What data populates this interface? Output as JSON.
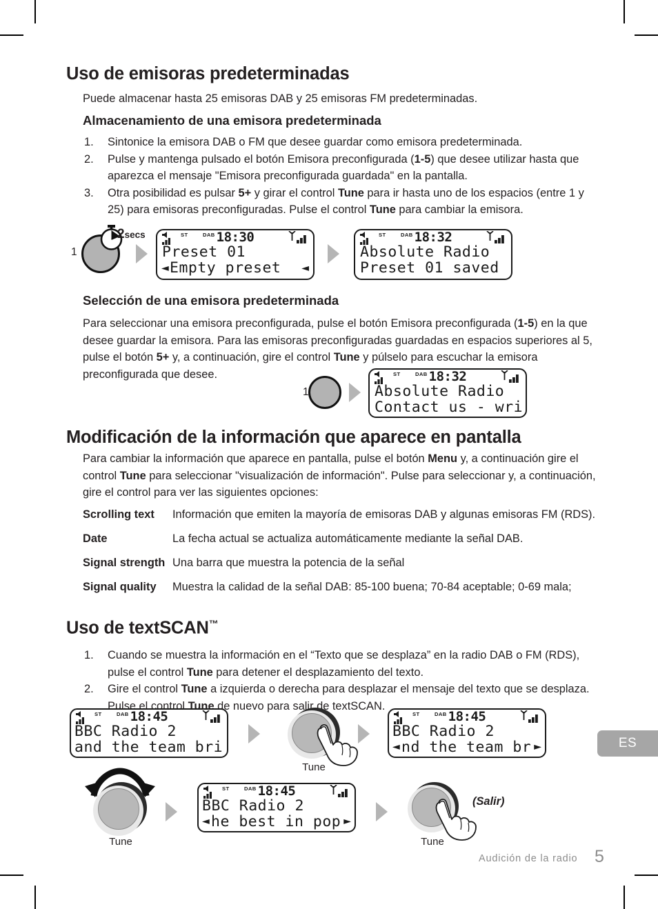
{
  "page": {
    "number": "5",
    "footer_section": "Audición de la radio",
    "language_tab": "ES"
  },
  "sections": {
    "presets": {
      "heading": "Uso de emisoras predeterminadas",
      "intro": "Puede almacenar hasta 25 emisoras DAB y 25 emisoras FM predeterminadas.",
      "store_heading": "Almacenamiento de una emisora predeterminada",
      "steps": [
        {
          "num": "1.",
          "text": "Sintonice la emisora DAB o FM que desee guardar como emisora predeterminada."
        },
        {
          "num": "2.",
          "text": "Pulse y mantenga pulsado el botón Emisora preconfigurada (1-5) que desee utilizar hasta que aparezca el mensaje \"Emisora preconfigurada guardada\" en la pantalla."
        },
        {
          "num": "3.",
          "text": "Otra posibilidad es pulsar 5+ y girar el control Tune para ir hasta uno de los espacios (entre 1 y 25) para emisoras preconfiguradas. Pulse el control Tune para cambiar la emisora."
        }
      ],
      "select_heading": "Selección de una emisora predeterminada",
      "select_body": "Para seleccionar una emisora preconfigurada, pulse el botón Emisora preconfigurada (1-5) en la que desee guardar la emisora. Para las emisoras preconfiguradas guardadas en espacios superiores al 5, pulse el botón 5+ y, a continuación, gire el control Tune y púlselo para escuchar la emisora preconfigurada que desee."
    },
    "display_info": {
      "heading": "Modificación de la información que aparece en pantalla",
      "body": "Para cambiar la información que aparece en pantalla, pulse el botón Menu y, a continuación gire el control Tune para seleccionar \"visualización de información\". Pulse para seleccionar y, a continuación, gire el control para ver las siguientes opciones:",
      "options": [
        {
          "term": "Scrolling text",
          "desc": "Información que emiten la mayoría de emisoras DAB y algunas emisoras FM (RDS)."
        },
        {
          "term": "Date",
          "desc": "La fecha actual se actualiza automáticamente mediante la señal DAB."
        },
        {
          "term": "Signal strength",
          "desc": "Una barra que muestra la potencia de la señal"
        },
        {
          "term": "Signal quality",
          "desc": "Muestra la calidad de la señal DAB: 85-100 buena; 70-84 aceptable; 0-69 mala;"
        }
      ]
    },
    "textscan": {
      "heading": "Uso de textSCAN",
      "heading_tm": "™",
      "steps": [
        {
          "num": "1.",
          "text": "Cuando se muestra la información en el “Texto que se desplaza” en la radio DAB o FM (RDS), pulse el control Tune para detener el desplazamiento del texto."
        },
        {
          "num": "2.",
          "text": "Gire el control Tune a izquierda o derecha para desplazar el mensaje del texto que se desplaza. Pulse el control Tune de nuevo para salir de textSCAN."
        }
      ]
    }
  },
  "diagrams": {
    "store_preset": {
      "step_label": "1",
      "hold_time": "2",
      "hold_unit": "secs",
      "screen_a": {
        "st": "ST",
        "dab": "DAB",
        "time": "18:30",
        "line1": "Preset 01",
        "line2": "Empty preset",
        "left_mark": "◄",
        "right_mark": "◄"
      },
      "screen_b": {
        "st": "ST",
        "dab": "DAB",
        "time": "18:32",
        "line1": "Absolute Radio",
        "line2": "Preset 01 saved"
      }
    },
    "select_preset": {
      "step_label": "1",
      "screen": {
        "st": "ST",
        "dab": "DAB",
        "time": "18:32",
        "line1": "Absolute Radio",
        "line2": "Contact us - wri"
      }
    },
    "textscan_flow": {
      "screen_1": {
        "st": "ST",
        "dab": "DAB",
        "time": "18:45",
        "line1": "BBC Radio 2",
        "line2": "and the team bri"
      },
      "knob_1_label": "Tune",
      "screen_2": {
        "st": "ST",
        "dab": "DAB",
        "time": "18:45",
        "line1": "BBC Radio 2",
        "line2": "nd the team br",
        "left_mark": "◄",
        "right_mark": "►"
      },
      "knob_2_label": "Tune",
      "screen_3": {
        "st": "ST",
        "dab": "DAB",
        "time": "18:45",
        "line1": "BBC Radio 2",
        "line2": "he best in pop",
        "left_mark": "◄",
        "right_mark": "►"
      },
      "knob_3_label": "Tune",
      "exit_label": "(Salir)"
    }
  }
}
